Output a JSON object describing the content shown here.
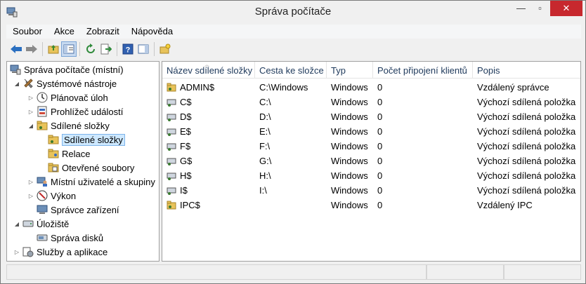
{
  "window": {
    "title": "Správa počítače"
  },
  "menu": [
    "Soubor",
    "Akce",
    "Zobrazit",
    "Nápověda"
  ],
  "toolbar_icons": [
    "back-icon",
    "forward-icon",
    "up-folder-icon",
    "show-hide-tree-icon",
    "refresh-icon",
    "export-list-icon",
    "help-icon",
    "action-pane-icon",
    "new-share-icon"
  ],
  "tree": [
    {
      "label": "Správa počítače (místní)",
      "icon": "computer-management-icon",
      "expander": ""
    },
    {
      "label": "Systémové nástroje",
      "icon": "system-tools-icon",
      "expander": "◢"
    },
    {
      "label": "Plánovač úloh",
      "icon": "task-scheduler-icon",
      "expander": "▷"
    },
    {
      "label": "Prohlížeč událostí",
      "icon": "event-viewer-icon",
      "expander": "▷"
    },
    {
      "label": "Sdílené složky",
      "icon": "shared-folders-icon",
      "expander": "◢"
    },
    {
      "label": "Sdílené složky",
      "icon": "shares-icon",
      "expander": "",
      "selected": true
    },
    {
      "label": "Relace",
      "icon": "sessions-icon",
      "expander": ""
    },
    {
      "label": "Otevřené soubory",
      "icon": "open-files-icon",
      "expander": ""
    },
    {
      "label": "Místní uživatelé a skupiny",
      "icon": "local-users-icon",
      "expander": "▷"
    },
    {
      "label": "Výkon",
      "icon": "performance-icon",
      "expander": "▷"
    },
    {
      "label": "Správce zařízení",
      "icon": "device-manager-icon",
      "expander": ""
    },
    {
      "label": "Úložiště",
      "icon": "storage-icon",
      "expander": "◢"
    },
    {
      "label": "Správa disků",
      "icon": "disk-management-icon",
      "expander": ""
    },
    {
      "label": "Služby a aplikace",
      "icon": "services-apps-icon",
      "expander": "▷"
    }
  ],
  "table": {
    "columns": [
      "Název sdílené složky",
      "Cesta ke složce",
      "Typ",
      "Počet připojení klientů",
      "Popis"
    ],
    "rows": [
      {
        "name": "ADMIN$",
        "path": "C:\\Windows",
        "type": "Windows",
        "clients": "0",
        "desc": "Vzdálený správce",
        "icon": "share-folder-icon"
      },
      {
        "name": "C$",
        "path": "C:\\",
        "type": "Windows",
        "clients": "0",
        "desc": "Výchozí sdílená položka",
        "icon": "share-drive-icon"
      },
      {
        "name": "D$",
        "path": "D:\\",
        "type": "Windows",
        "clients": "0",
        "desc": "Výchozí sdílená položka",
        "icon": "share-drive-icon"
      },
      {
        "name": "E$",
        "path": "E:\\",
        "type": "Windows",
        "clients": "0",
        "desc": "Výchozí sdílená položka",
        "icon": "share-drive-icon"
      },
      {
        "name": "F$",
        "path": "F:\\",
        "type": "Windows",
        "clients": "0",
        "desc": "Výchozí sdílená položka",
        "icon": "share-drive-icon"
      },
      {
        "name": "G$",
        "path": "G:\\",
        "type": "Windows",
        "clients": "0",
        "desc": "Výchozí sdílená položka",
        "icon": "share-drive-icon"
      },
      {
        "name": "H$",
        "path": "H:\\",
        "type": "Windows",
        "clients": "0",
        "desc": "Výchozí sdílená položka",
        "icon": "share-drive-icon"
      },
      {
        "name": "I$",
        "path": "I:\\",
        "type": "Windows",
        "clients": "0",
        "desc": "Výchozí sdílená položka",
        "icon": "share-drive-icon"
      },
      {
        "name": "IPC$",
        "path": "",
        "type": "Windows",
        "clients": "0",
        "desc": "Vzdálený IPC",
        "icon": "share-folder-icon"
      }
    ]
  },
  "colors": {
    "close_button": "#c7282e",
    "selection": "#cde8ff",
    "header_text": "#1e395b"
  }
}
